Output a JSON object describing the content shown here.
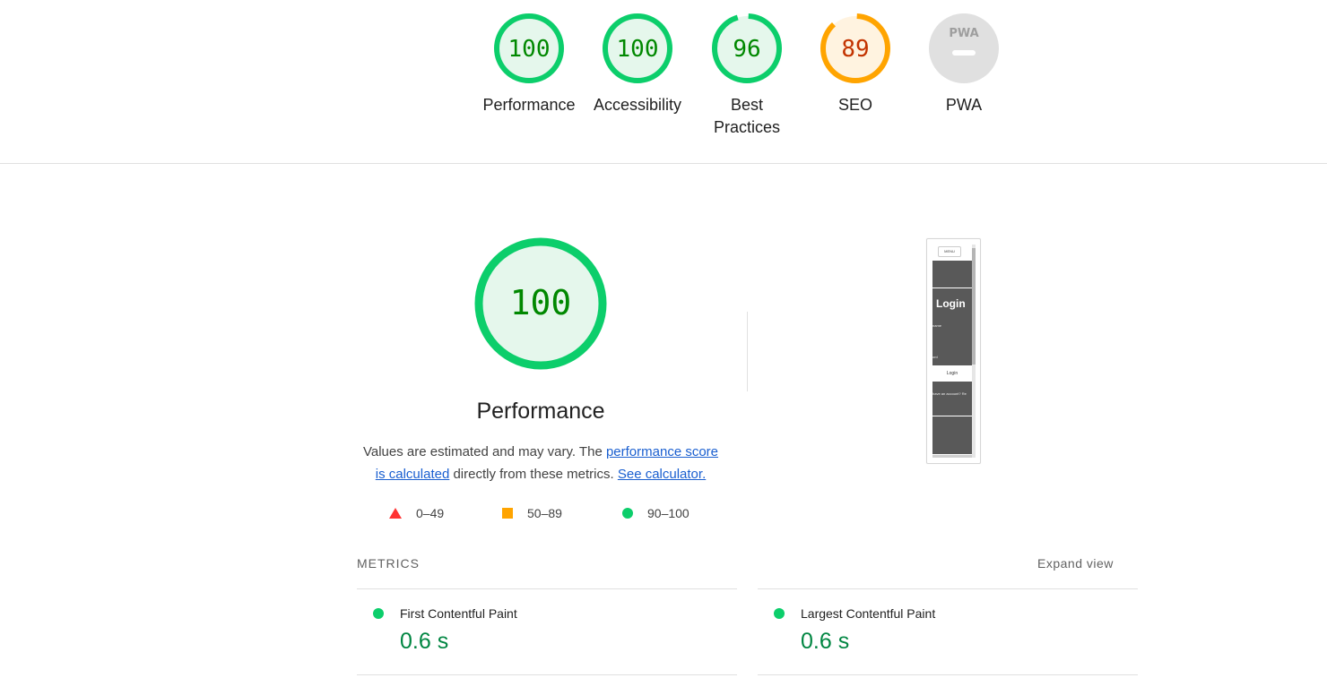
{
  "top_gauges": [
    {
      "score": "100",
      "label_lines": [
        "Performance"
      ],
      "status": "pass",
      "fraction": 1.0
    },
    {
      "score": "100",
      "label_lines": [
        "Accessibility"
      ],
      "status": "pass",
      "fraction": 1.0
    },
    {
      "score": "96",
      "label_lines": [
        "Best",
        "Practices"
      ],
      "status": "pass",
      "fraction": 0.96
    },
    {
      "score": "89",
      "label_lines": [
        "SEO"
      ],
      "status": "average",
      "fraction": 0.89
    },
    {
      "score": "",
      "label_lines": [
        "PWA"
      ],
      "status": "na",
      "badge": "PWA",
      "fraction": 0
    }
  ],
  "colors": {
    "pass": "#0cce6b",
    "pass_bg": "#e5f7ec",
    "pass_text": "#008800",
    "average": "#ffa400",
    "average_bg": "#fff3e0",
    "average_text": "#c33300",
    "fail": "#ff3333",
    "na": "#e0e0e0",
    "na_text": "#9e9e9e",
    "link": "#1a5fd0",
    "metric_value": "#018642"
  },
  "performance": {
    "score": "100",
    "fraction": 1.0,
    "title": "Performance",
    "desc_prefix": "Values are estimated and may vary. The ",
    "desc_link1": "performance score is calculated",
    "desc_middle": " directly from these metrics. ",
    "desc_link2": "See calculator."
  },
  "legend": [
    {
      "shape": "triangle",
      "range": "0–49"
    },
    {
      "shape": "square",
      "range": "50–89"
    },
    {
      "shape": "circle",
      "range": "90–100"
    }
  ],
  "thumbnail": {
    "menu": "MENU",
    "heading": "Login",
    "field1": "name",
    "field2": "ord",
    "button": "Login",
    "footer": "have an account? Re"
  },
  "metrics": {
    "title": "METRICS",
    "expand": "Expand view",
    "items": [
      {
        "name": "First Contentful Paint",
        "value": "0.6 s",
        "status": "pass"
      },
      {
        "name": "Largest Contentful Paint",
        "value": "0.6 s",
        "status": "pass"
      }
    ]
  }
}
